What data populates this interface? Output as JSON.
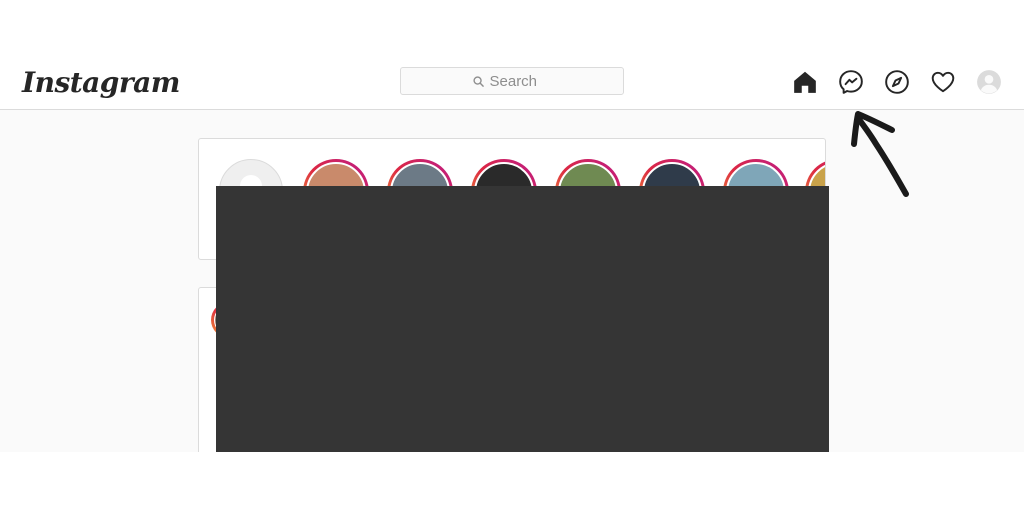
{
  "header": {
    "logo_text": "Instagram",
    "search": {
      "placeholder": "Search",
      "icon": "search-icon"
    },
    "nav_icons": [
      "home-icon",
      "messenger-icon",
      "explore-compass-icon",
      "activity-heart-icon",
      "profile-avatar-icon"
    ]
  },
  "stories": {
    "items": [
      {
        "color": "#c98a6b"
      },
      {
        "color": "#6c7a86"
      },
      {
        "color": "#2a2a2a"
      },
      {
        "color": "#6f8a52"
      },
      {
        "color": "#2f3b4a"
      },
      {
        "color": "#7fa6b8"
      },
      {
        "color": "#c9a24a"
      }
    ]
  },
  "colors": {
    "ring_gradient_start": "#f09433",
    "ring_gradient_end": "#bc1888",
    "redaction": "#353535",
    "border": "#dbdbdb",
    "feed_background": "#fafafa"
  }
}
